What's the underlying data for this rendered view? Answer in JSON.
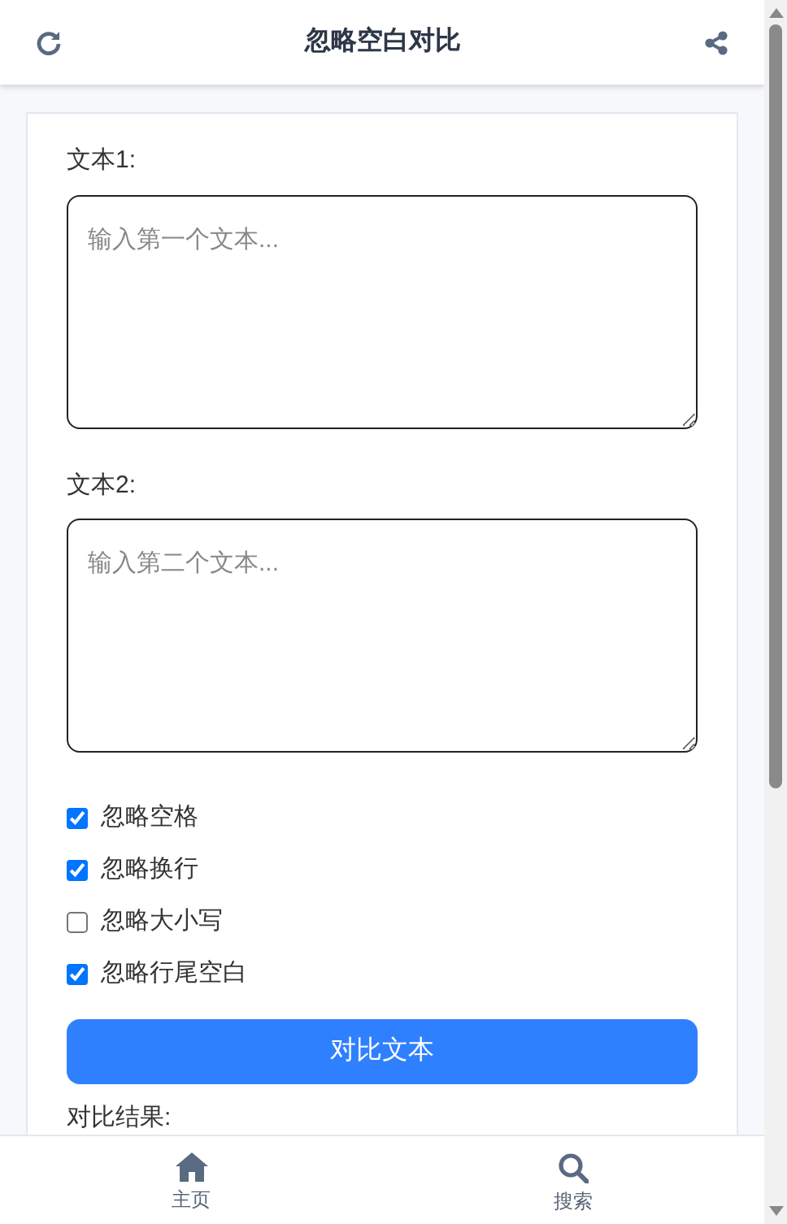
{
  "header": {
    "title": "忽略空白对比"
  },
  "fields": [
    {
      "label": "文本1:",
      "placeholder": "输入第一个文本..."
    },
    {
      "label": "文本2:",
      "placeholder": "输入第二个文本..."
    }
  ],
  "options": [
    {
      "label": "忽略空格",
      "checked": true
    },
    {
      "label": "忽略换行",
      "checked": true
    },
    {
      "label": "忽略大小写",
      "checked": false
    },
    {
      "label": "忽略行尾空白",
      "checked": true
    }
  ],
  "compare_button": "对比文本",
  "result_label": "对比结果:",
  "bottom_nav": [
    {
      "label": "主页",
      "kind": "home"
    },
    {
      "label": "搜索",
      "kind": "search"
    }
  ]
}
